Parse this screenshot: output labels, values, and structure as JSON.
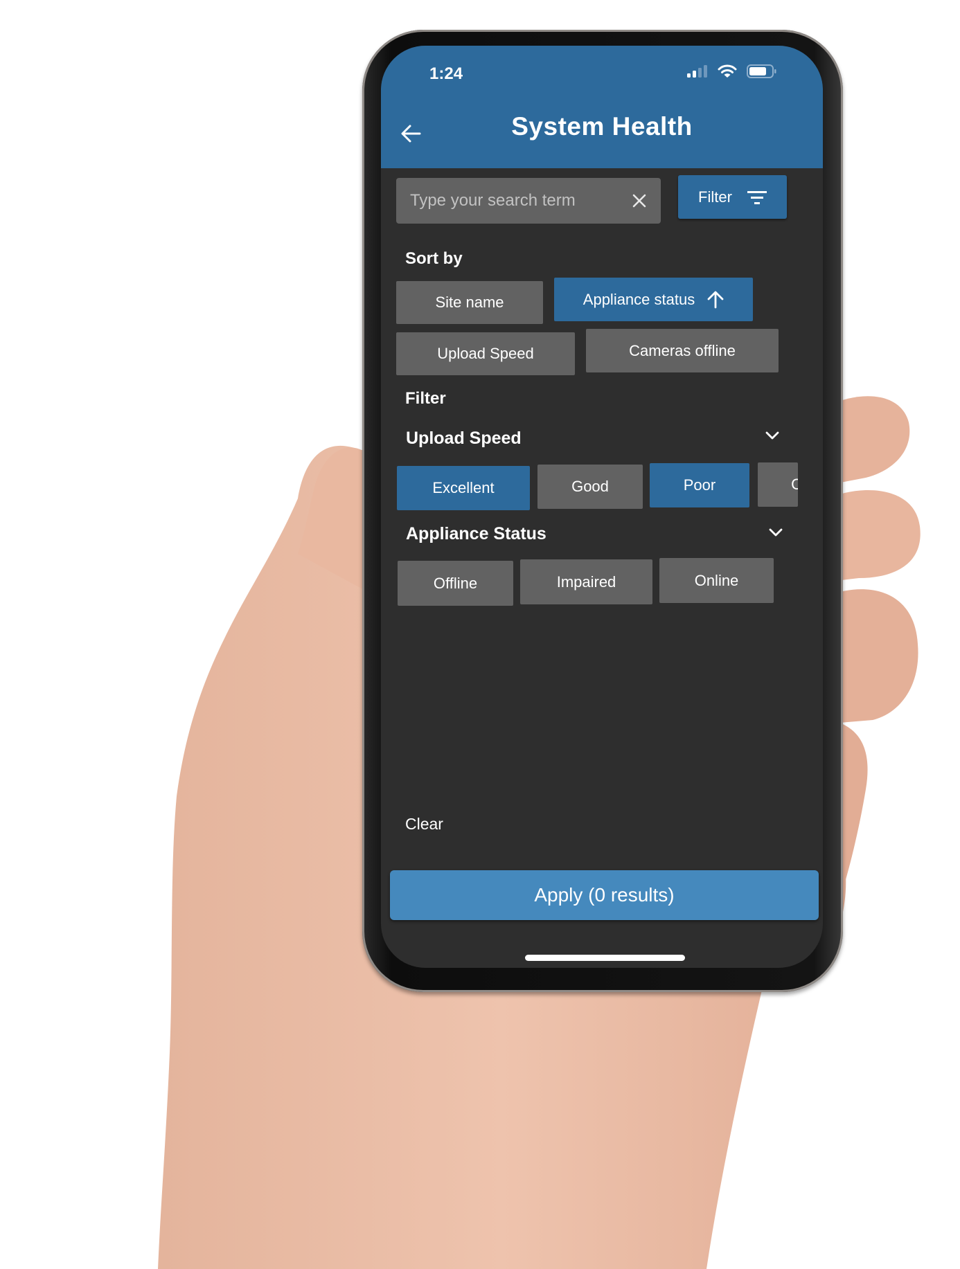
{
  "status_bar": {
    "time": "1:24",
    "icons": [
      "cellular-signal-icon",
      "wifi-icon",
      "battery-icon"
    ]
  },
  "header": {
    "title": "System Health",
    "back_icon": "arrow-left-icon"
  },
  "search": {
    "value": "",
    "placeholder": "Type your search term",
    "clear_icon": "close-icon"
  },
  "filter_button": {
    "label": "Filter",
    "icon": "filter-lines-icon"
  },
  "sort": {
    "label": "Sort by",
    "options": [
      {
        "label": "Site name",
        "active": false
      },
      {
        "label": "Appliance status",
        "active": true,
        "direction": "ascending",
        "icon": "arrow-up-icon"
      },
      {
        "label": "Upload Speed",
        "active": false
      },
      {
        "label": "Cameras offline",
        "active": false
      }
    ]
  },
  "filter": {
    "label": "Filter",
    "groups": [
      {
        "title": "Upload Speed",
        "expand_icon": "chevron-down-icon",
        "options": [
          {
            "label": "Excellent",
            "selected": true
          },
          {
            "label": "Good",
            "selected": false
          },
          {
            "label": "Poor",
            "selected": true
          },
          {
            "label": "C",
            "selected": false
          }
        ]
      },
      {
        "title": "Appliance Status",
        "expand_icon": "chevron-down-icon",
        "options": [
          {
            "label": "Offline",
            "selected": false
          },
          {
            "label": "Impaired",
            "selected": false
          },
          {
            "label": "Online",
            "selected": false
          }
        ]
      }
    ]
  },
  "footer": {
    "clear_label": "Clear",
    "apply_label": "Apply (0 results)"
  },
  "colors": {
    "header": "#2d6a9c",
    "active_chip": "#2d6a9c",
    "inactive_chip": "#626262",
    "background": "#2e2e2e",
    "apply_button": "#4589bd"
  }
}
